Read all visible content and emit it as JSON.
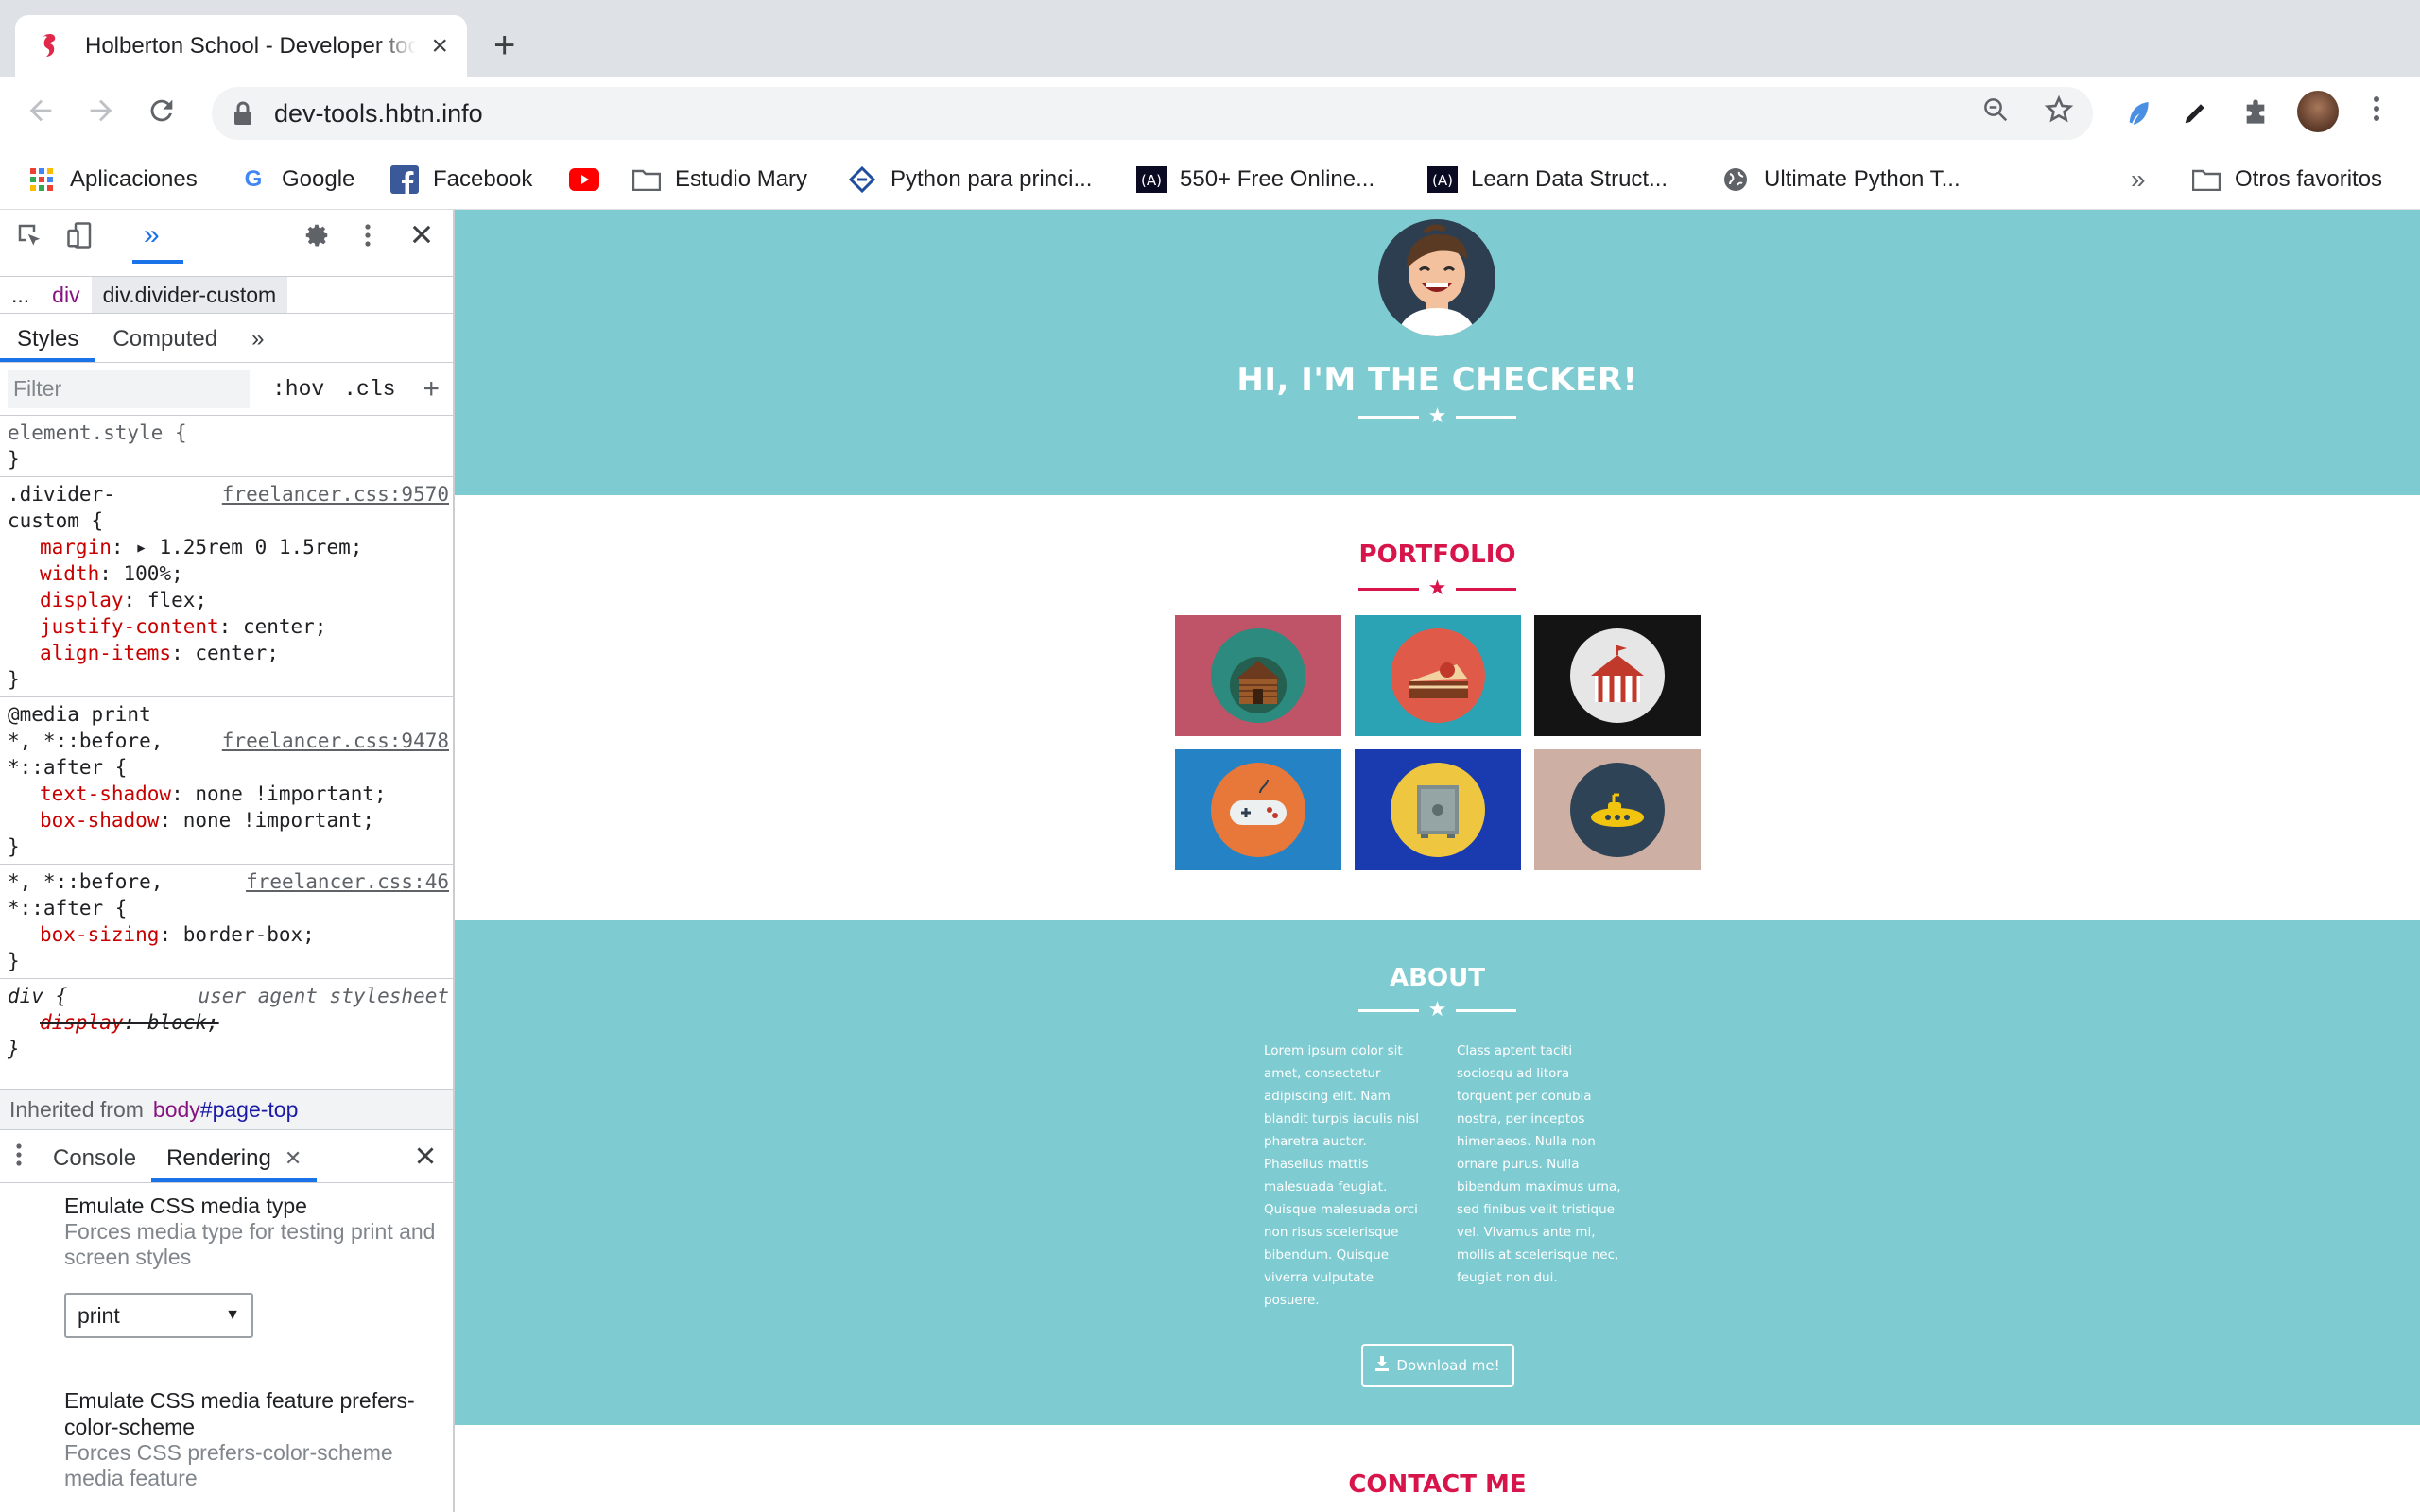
{
  "browser": {
    "tab_title": "Holberton School - Developer tools",
    "new_tab": "+",
    "close": "×",
    "url": "dev-tools.hbtn.info"
  },
  "bookmarks": [
    {
      "label": "Aplicaciones",
      "icon": "apps-grid-icon"
    },
    {
      "label": "Google",
      "icon": "google-icon"
    },
    {
      "label": "Facebook",
      "icon": "facebook-icon"
    },
    {
      "label": "",
      "icon": "youtube-icon"
    },
    {
      "label": "Estudio Mary",
      "icon": "folder-icon"
    },
    {
      "label": "Python para princi...",
      "icon": "site-icon"
    },
    {
      "label": "550+ Free Online...",
      "icon": "freecodecamp-icon"
    },
    {
      "label": "Learn Data Struct...",
      "icon": "freecodecamp-icon"
    },
    {
      "label": "Ultimate Python T...",
      "icon": "globe-icon"
    }
  ],
  "bookmarks_more": "»",
  "other_bookmarks": "Otros favoritos",
  "devtools": {
    "more_tabs": "»",
    "breadcrumb": {
      "ellipsis": "...",
      "parent": "div",
      "selected": "div.divider-custom"
    },
    "subtabs": [
      "Styles",
      "Computed",
      "»"
    ],
    "filter_placeholder": "Filter",
    "hov": ":hov",
    "cls": ".cls",
    "plus": "+",
    "rules": {
      "element_style": "element.style {",
      "close": "}",
      "r1": {
        "selector_a": ".divider-",
        "selector_b": "custom {",
        "source": "freelancer.css:9570",
        "decls": [
          {
            "prop": "margin",
            "val": "▸ 1.25rem 0 1.5rem;"
          },
          {
            "prop": "width",
            "val": "100%;"
          },
          {
            "prop": "display",
            "val": "flex;"
          },
          {
            "prop": "justify-content",
            "val": "center;"
          },
          {
            "prop": "align-items",
            "val": "center;"
          }
        ]
      },
      "r2": {
        "media": "@media print",
        "selector_a": "*, *::before,",
        "selector_b": "*::after {",
        "source": "freelancer.css:9478",
        "decls": [
          {
            "prop": "text-shadow",
            "val": "none !important;"
          },
          {
            "prop": "box-shadow",
            "val": "none !important;"
          }
        ]
      },
      "r3": {
        "selector_a": "*, *::before,",
        "selector_b": "*::after {",
        "source": "freelancer.css:46",
        "decls": [
          {
            "prop": "box-sizing",
            "val": "border-box;"
          }
        ]
      },
      "r4": {
        "selector": "div {",
        "source": "user agent stylesheet",
        "decls": [
          {
            "prop": "display",
            "val": "block;"
          }
        ]
      }
    },
    "inherited_label": "Inherited from",
    "inherited_tag": "body",
    "inherited_id": "#page-top",
    "drawer_tabs": [
      "Console",
      "Rendering"
    ],
    "rendering": {
      "media_type_title": "Emulate CSS media type",
      "media_type_desc": "Forces media type for testing print and screen styles",
      "media_type_value": "print",
      "feature_title": "Emulate CSS media feature prefers-color-scheme",
      "feature_desc": "Forces CSS prefers-color-scheme media feature"
    }
  },
  "site": {
    "masthead_title": "HI, I'M THE CHECKER!",
    "portfolio_title": "PORTFOLIO",
    "portfolio_items": [
      {
        "name": "cabin",
        "bg": "#bf5468",
        "disc": "#2c8a7e"
      },
      {
        "name": "cake",
        "bg": "#2ba3b4",
        "disc": "#e05a4a"
      },
      {
        "name": "circus",
        "bg": "#141414",
        "disc": "#e6e6e6"
      },
      {
        "name": "game",
        "bg": "#2582c4",
        "disc": "#e8783a"
      },
      {
        "name": "safe",
        "bg": "#1a3bb0",
        "disc": "#efc640"
      },
      {
        "name": "submarine",
        "bg": "#cdafa3",
        "disc": "#2f4356"
      }
    ],
    "about_title": "ABOUT",
    "about_left": "Lorem ipsum dolor sit amet, consectetur adipiscing elit. Nam blandit turpis iaculis nisl pharetra auctor. Phasellus mattis malesuada feugiat. Quisque malesuada orci non risus scelerisque bibendum. Quisque viverra vulputate posuere.",
    "about_right": "Class aptent taciti sociosqu ad litora torquent per conubia nostra, per inceptos himenaeos. Nulla non ornare purus. Nulla bibendum maximus urna, sed finibus velit tristique vel. Vivamus ante mi, mollis at scelerisque nec, feugiat non dui.",
    "download_label": "Download me!",
    "contact_title": "CONTACT ME"
  },
  "colors": {
    "teal": "#7ecbd1",
    "pink": "#d7154a",
    "link_blue": "#1a73e8"
  }
}
